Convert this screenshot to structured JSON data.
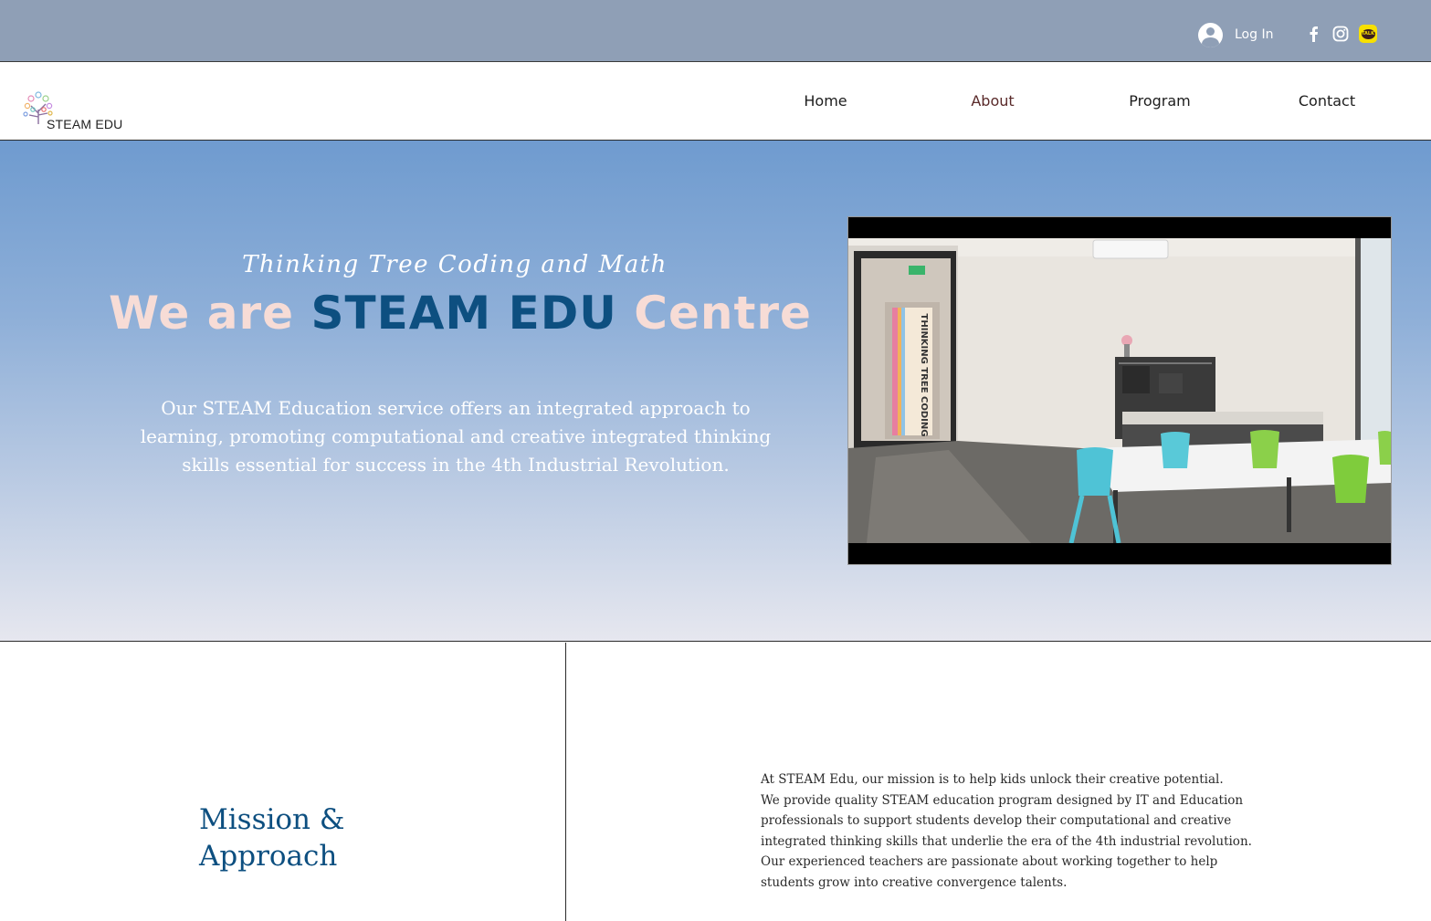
{
  "topbar": {
    "login_label": "Log In",
    "socials": [
      "facebook-icon",
      "instagram-icon",
      "kakaotalk-icon"
    ],
    "kakao_text": "TALK"
  },
  "header": {
    "brand": "STEAM EDU",
    "nav": [
      {
        "label": "Home",
        "active": false
      },
      {
        "label": "About",
        "active": true
      },
      {
        "label": "Program",
        "active": false
      },
      {
        "label": "Contact",
        "active": false
      }
    ]
  },
  "hero": {
    "subtitle": "Thinking Tree Coding and Math",
    "headline": {
      "part1": "We are ",
      "part2": "STEAM EDU",
      "part3": " Centre"
    },
    "description": "Our STEAM Education service offers an integrated approach to learning, promoting computational and creative integrated thinking skills essential for success in the 4th Industrial Revolution.",
    "video_sign": "THINKING TREE CODING"
  },
  "mission": {
    "title_line1": "Mission &",
    "title_line2": "Approach",
    "body_lines": [
      "At STEAM Edu, our mission is to help kids unlock their creative potential.",
      "We provide quality STEAM education program designed by IT and Education",
      "professionals to support students develop their computational and creative",
      "integrated thinking skills that underlie the era of the 4th industrial revolution.",
      "Our experienced teachers are passionate about working together to help",
      "students grow into creative convergence talents."
    ]
  },
  "colors": {
    "topbar": "#8f9fb6",
    "brand_blue": "#0d4f80",
    "headline_pink": "#f7dcd6",
    "kakao_yellow": "#f7e000"
  }
}
